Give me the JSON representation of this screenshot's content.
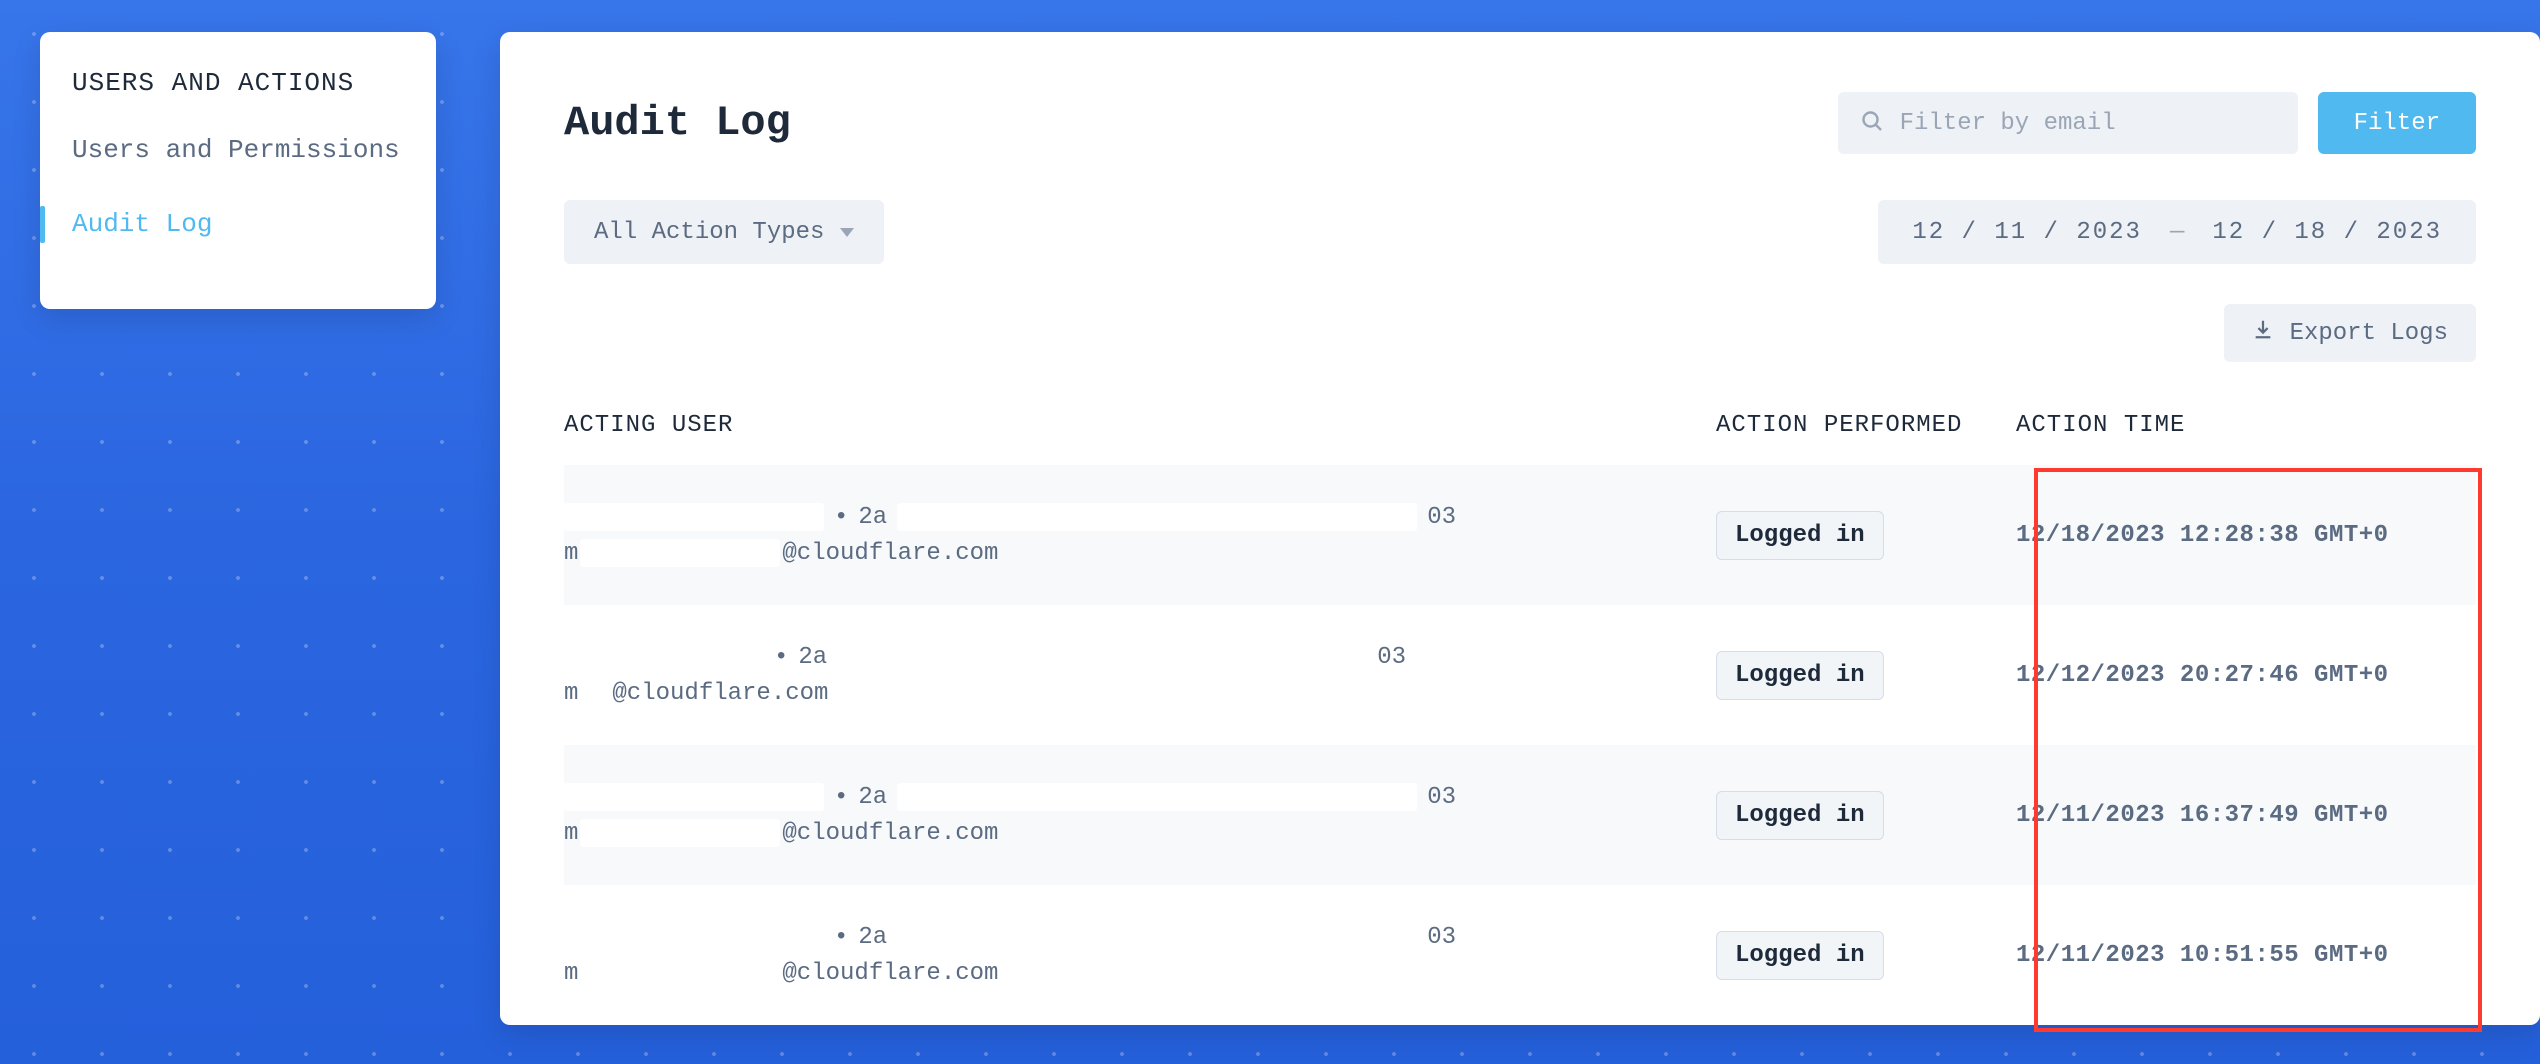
{
  "sidebar": {
    "title": "USERS AND ACTIONS",
    "items": [
      {
        "label": "Users and Permissions",
        "active": false
      },
      {
        "label": "Audit Log",
        "active": true
      }
    ]
  },
  "page": {
    "title": "Audit Log"
  },
  "search": {
    "placeholder": "Filter by email",
    "value": ""
  },
  "filter_button": "Filter",
  "action_type_select": {
    "selected": "All Action Types"
  },
  "date_range": {
    "from": "12 / 11 / 2023",
    "to": "12 / 18 / 2023",
    "separator": "—"
  },
  "export_button": "Export Logs",
  "table": {
    "headers": {
      "user": "ACTING USER",
      "action": "ACTION PERFORMED",
      "time": "ACTION TIME"
    },
    "rows": [
      {
        "line1_prefix": "",
        "line1_sep": "•",
        "line1_mid": "2a",
        "line1_suffix": "03",
        "line2_prefix": "m",
        "line2_suffix": "@cloudflare.com",
        "action": "Logged in",
        "time": "12/18/2023 12:28:38 GMT+0"
      },
      {
        "line1_prefix": "",
        "line1_sep": "•",
        "line1_mid": "2a",
        "line1_suffix": "03",
        "line2_prefix": "m",
        "line2_suffix": "@cloudflare.com",
        "action": "Logged in",
        "time": "12/12/2023 20:27:46 GMT+0"
      },
      {
        "line1_prefix": "",
        "line1_sep": "•",
        "line1_mid": "2a",
        "line1_suffix": "03",
        "line2_prefix": "m",
        "line2_suffix": "@cloudflare.com",
        "action": "Logged in",
        "time": "12/11/2023 16:37:49 GMT+0"
      },
      {
        "line1_prefix": "",
        "line1_sep": "•",
        "line1_mid": "2a",
        "line1_suffix": "03",
        "line2_prefix": "m",
        "line2_suffix": "@cloudflare.com",
        "action": "Logged in",
        "time": "12/11/2023 10:51:55 GMT+0"
      }
    ]
  }
}
